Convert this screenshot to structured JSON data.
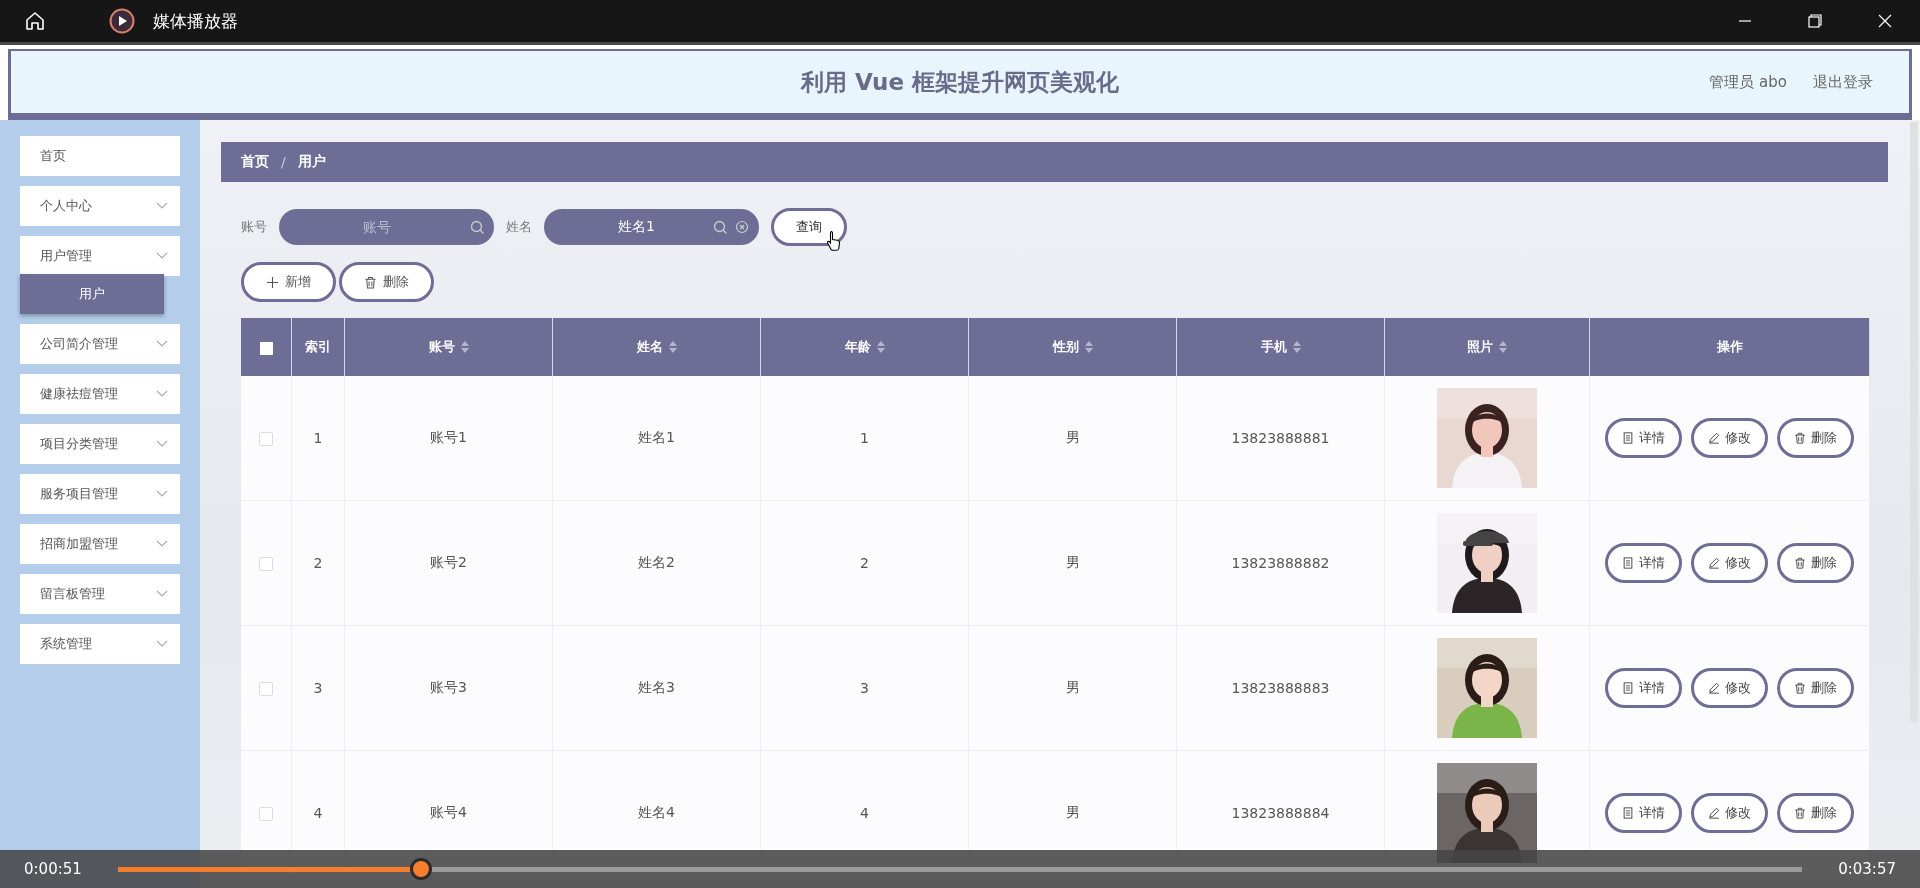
{
  "window": {
    "title": "媒体播放器"
  },
  "header": {
    "title": "利用 Vue 框架提升网页美观化",
    "user": "管理员 abo",
    "logout": "退出登录"
  },
  "sidebar": {
    "items": [
      {
        "label": "首页",
        "kind": "link"
      },
      {
        "label": "个人中心",
        "kind": "submenu"
      },
      {
        "label": "用户管理",
        "kind": "submenu",
        "children": [
          {
            "label": "用户",
            "selected": true
          }
        ]
      },
      {
        "label": "公司简介管理",
        "kind": "submenu"
      },
      {
        "label": "健康祛痘管理",
        "kind": "submenu"
      },
      {
        "label": "项目分类管理",
        "kind": "submenu"
      },
      {
        "label": "服务项目管理",
        "kind": "submenu"
      },
      {
        "label": "招商加盟管理",
        "kind": "submenu"
      },
      {
        "label": "留言板管理",
        "kind": "submenu"
      },
      {
        "label": "系统管理",
        "kind": "submenu"
      }
    ]
  },
  "breadcrumb": {
    "items": [
      "首页",
      "用户"
    ],
    "separator": "/"
  },
  "search": {
    "fields": [
      {
        "label": "账号",
        "placeholder": "账号",
        "clearable": false
      },
      {
        "label": "姓名",
        "value": "姓名1",
        "clearable": true
      }
    ],
    "button": "查询"
  },
  "actions": [
    {
      "label": "新增",
      "kind": "add"
    },
    {
      "label": "删除",
      "kind": "delete"
    }
  ],
  "table": {
    "select_all_checked": false,
    "columns": [
      {
        "label": "索引",
        "sortable": false
      },
      {
        "label": "账号",
        "sortable": true
      },
      {
        "label": "姓名",
        "sortable": true
      },
      {
        "label": "年龄",
        "sortable": true
      },
      {
        "label": "性别",
        "sortable": true
      },
      {
        "label": "手机",
        "sortable": true
      },
      {
        "label": "照片",
        "sortable": true
      },
      {
        "label": "操作",
        "sortable": false
      }
    ],
    "rows": [
      {
        "checked": false,
        "cells": [
          "1",
          "账号1",
          "姓名1",
          "1",
          "男",
          "13823888881"
        ],
        "photo": {
          "kind": "picture"
        },
        "buttons": [
          {
            "label": "详情",
            "kind": "detail"
          },
          {
            "label": "修改",
            "kind": "edit"
          },
          {
            "label": "删除",
            "kind": "delete"
          }
        ]
      },
      {
        "checked": false,
        "cells": [
          "2",
          "账号2",
          "姓名2",
          "2",
          "男",
          "13823888882"
        ],
        "photo": {
          "kind": "picture"
        },
        "buttons": [
          {
            "label": "详情",
            "kind": "detail"
          },
          {
            "label": "修改",
            "kind": "edit"
          },
          {
            "label": "删除",
            "kind": "delete"
          }
        ]
      },
      {
        "checked": false,
        "cells": [
          "3",
          "账号3",
          "姓名3",
          "3",
          "男",
          "13823888883"
        ],
        "photo": {
          "kind": "picture"
        },
        "buttons": [
          {
            "label": "详情",
            "kind": "detail"
          },
          {
            "label": "修改",
            "kind": "edit"
          },
          {
            "label": "删除",
            "kind": "delete"
          }
        ]
      },
      {
        "checked": false,
        "cells": [
          "4",
          "账号4",
          "姓名4",
          "4",
          "男",
          "13823888884"
        ],
        "photo": {
          "kind": "picture"
        },
        "buttons": [
          {
            "label": "详情",
            "kind": "detail"
          },
          {
            "label": "修改",
            "kind": "edit"
          },
          {
            "label": "删除",
            "kind": "delete"
          }
        ]
      }
    ]
  },
  "player": {
    "elapsed": "0:00:51",
    "total": "0:03:57",
    "level": 0.18
  }
}
